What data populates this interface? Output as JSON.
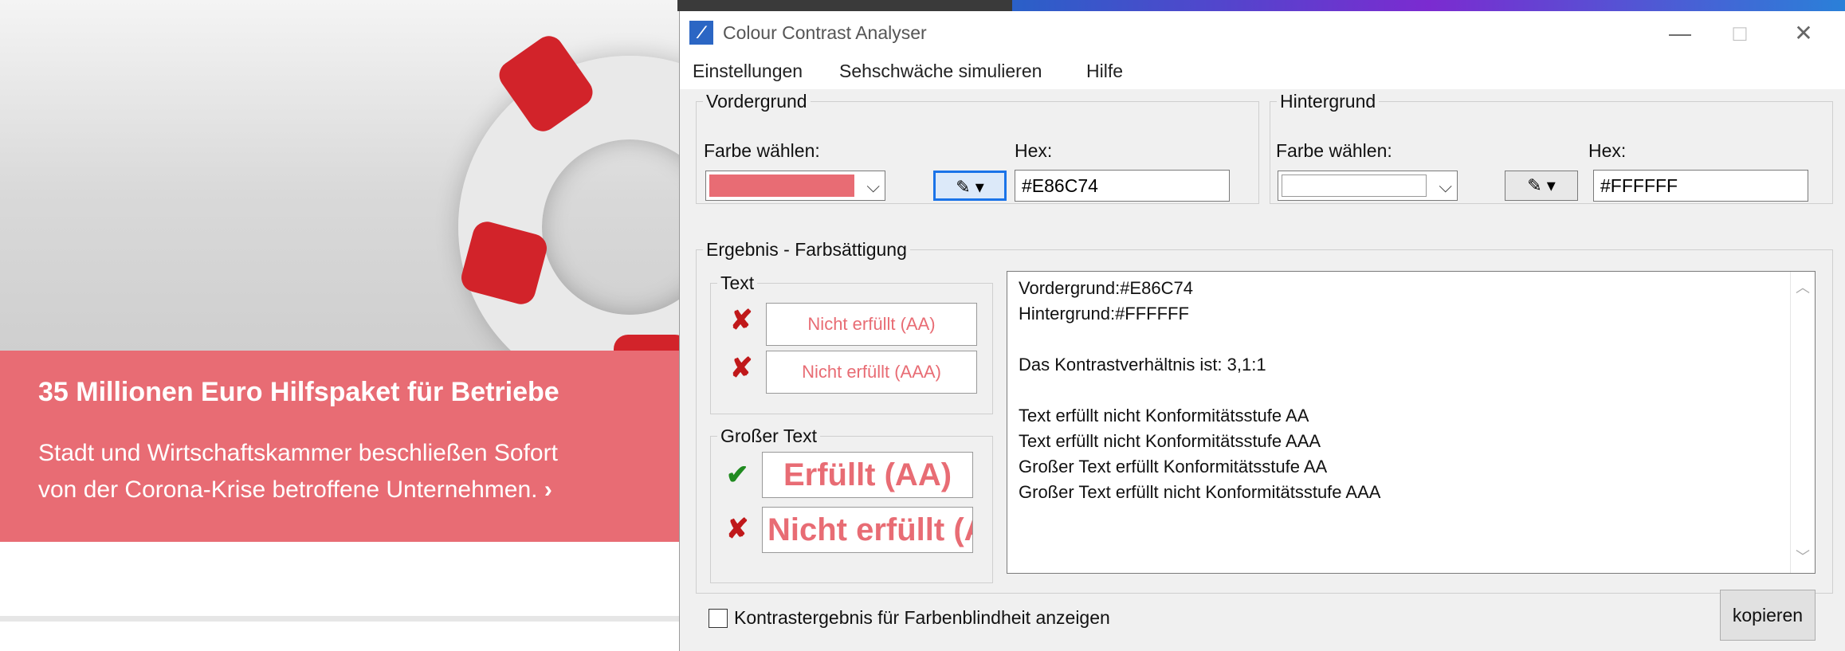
{
  "background_page": {
    "headline": "35 Millionen Euro Hilfspaket für Betriebe",
    "text_line1": "Stadt und Wirtschaftskammer beschließen Sofort",
    "text_line2": "von der Corona-Krise betroffene Unternehmen.",
    "arrow": "›",
    "banner_color": "#e86c74"
  },
  "window": {
    "title": "Colour Contrast Analyser",
    "minimize": "—",
    "maximize": "□",
    "close": "✕"
  },
  "menu": [
    "Einstellungen",
    "Sehschwäche simulieren",
    "Hilfe"
  ],
  "foreground": {
    "group_label": "Vordergrund",
    "pick_label": "Farbe wählen:",
    "hex_label": "Hex:",
    "hex_value": "#E86C74",
    "color": "#e86c74"
  },
  "background": {
    "group_label": "Hintergrund",
    "pick_label": "Farbe wählen:",
    "hex_label": "Hex:",
    "hex_value": "#FFFFFF",
    "color": "#ffffff"
  },
  "result": {
    "group_label": "Ergebnis - Farbsättigung",
    "text_group": "Text",
    "text_aa": "Nicht erfüllt (AA)",
    "text_aaa": "Nicht erfüllt (AAA)",
    "large_group": "Großer Text",
    "large_aa": "Erfüllt (AA)",
    "large_aaa": "Nicht erfüllt (AAA)",
    "status": {
      "text_aa": "fail",
      "text_aaa": "fail",
      "large_aa": "pass",
      "large_aaa": "fail"
    },
    "fail_mark": "✘",
    "pass_mark": "✔",
    "report_lines": [
      "Vordergrund:#E86C74",
      "Hintergrund:#FFFFFF",
      "",
      "Das Kontrastverhältnis ist: 3,1:1",
      "",
      "Text erfüllt nicht Konformitätsstufe AA",
      "Text erfüllt nicht Konformitätsstufe AAA",
      "Großer Text erfüllt Konformitätsstufe AA",
      "Großer Text erfüllt nicht Konformitätsstufe AAA"
    ]
  },
  "footer": {
    "checkbox_label": "Kontrastergebnis für Farbenblindheit anzeigen",
    "checkbox_checked": false,
    "copy_button": "kopieren"
  }
}
